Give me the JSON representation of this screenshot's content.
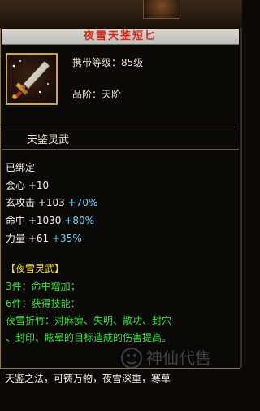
{
  "item": {
    "name": "夜雪天鉴短匕",
    "carry_level": "携带等级：85级",
    "grade": "品阶：天阶",
    "section_label": "天鉴灵武"
  },
  "binding": "已绑定",
  "stats": [
    {
      "name": "会心",
      "base": "+10",
      "bonus": ""
    },
    {
      "name": "玄攻击",
      "base": "+103",
      "bonus": "+70%"
    },
    {
      "name": "命中",
      "base": "+1030",
      "bonus": "+80%"
    },
    {
      "name": "力量",
      "base": "+61",
      "bonus": "+35%"
    }
  ],
  "set": {
    "title": "【夜雪灵武】",
    "three_piece": "3件：命中增加；",
    "six_piece": "6件：获得技能：",
    "skill_line1": "夜雪折竹：对麻痹、失明、散功、封穴",
    "skill_line2": "、封印、眩晕的目标造成的伤害提高。"
  },
  "description": "天鉴之法，可铸万物，夜雪深重，寒草",
  "watermark_text": "神仙代售",
  "colors": {
    "title": "#d22a1c",
    "set": "#f0e020",
    "set_effects": "#35e23a",
    "bonus": "#6ed3ff"
  },
  "icon": "dagger-icon"
}
